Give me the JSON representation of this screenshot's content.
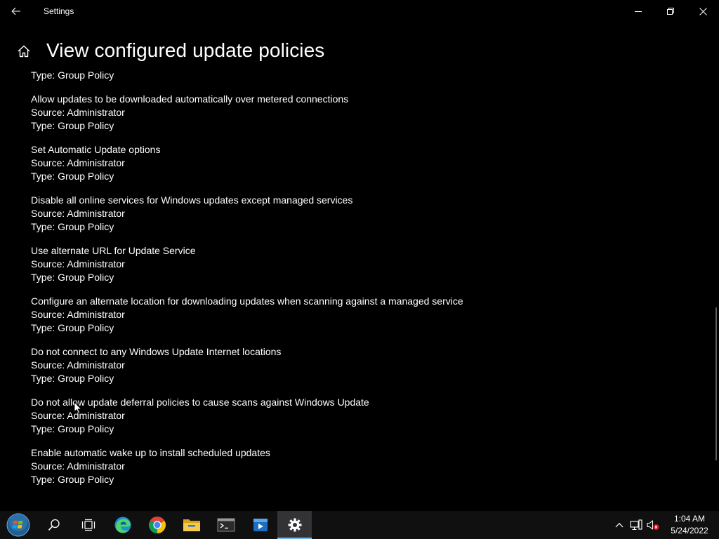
{
  "window": {
    "title": "Settings",
    "back_icon": "back-arrow-icon",
    "controls": [
      "minimize-icon",
      "restore-icon",
      "close-icon"
    ]
  },
  "header": {
    "home_icon": "home-icon",
    "title": "View configured update policies"
  },
  "first_partial_type": "Type: Group Policy",
  "policies": [
    {
      "name": "Allow updates to be downloaded automatically over metered connections",
      "source": "Source: Administrator",
      "type": "Type: Group Policy"
    },
    {
      "name": "Set Automatic Update options",
      "source": "Source: Administrator",
      "type": "Type: Group Policy"
    },
    {
      "name": "Disable all online services for Windows updates except managed services",
      "source": "Source: Administrator",
      "type": "Type: Group Policy"
    },
    {
      "name": "Use alternate URL for Update Service",
      "source": "Source: Administrator",
      "type": "Type: Group Policy"
    },
    {
      "name": "Configure an alternate location for downloading updates when scanning against a managed service",
      "source": "Source: Administrator",
      "type": "Type: Group Policy"
    },
    {
      "name": "Do not connect to any Windows Update Internet locations",
      "source": "Source: Administrator",
      "type": "Type: Group Policy"
    },
    {
      "name": "Do not allow update deferral policies to cause scans against Windows Update",
      "source": "Source: Administrator",
      "type": "Type: Group Policy"
    },
    {
      "name": "Enable automatic wake up to install scheduled updates",
      "source": "Source: Administrator",
      "type": "Type: Group Policy"
    }
  ],
  "taskbar": {
    "items": [
      "start-orb-icon",
      "search-icon",
      "task-view-icon",
      "edge-icon",
      "chrome-icon",
      "file-explorer-icon",
      "terminal-icon",
      "media-player-icon",
      "settings-gear-icon"
    ],
    "active_item": "settings-gear-icon",
    "accent": "#76b9ed",
    "tray_icons": [
      "chevron-up-icon",
      "network-icon",
      "volume-muted-icon"
    ],
    "time": "1:04 AM",
    "date": "5/24/2022"
  }
}
